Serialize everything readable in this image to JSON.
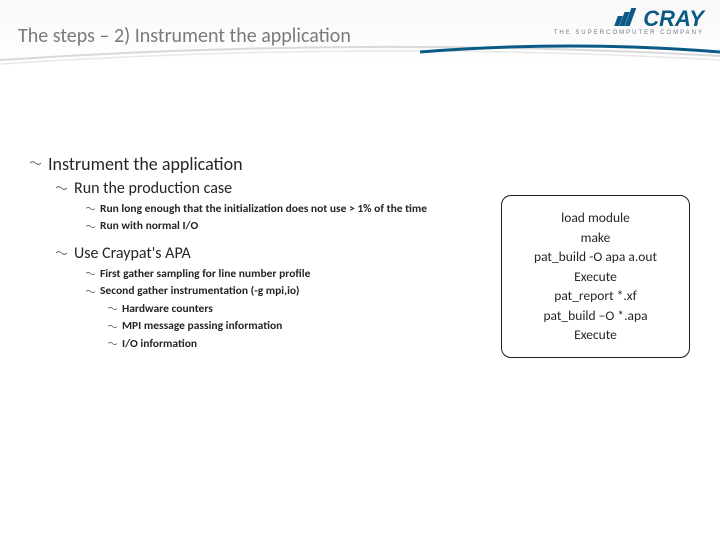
{
  "brand": {
    "name": "CRAY",
    "tagline": "THE SUPERCOMPUTER COMPANY"
  },
  "title": "The steps – 2) Instrument the application",
  "content": {
    "l1": "Instrument the application",
    "l2a": "Run the production case",
    "l3a": "Run long enough that the initialization does not use > 1% of the time",
    "l3b": "Run with normal I/O",
    "l2b": "Use Craypat's APA",
    "l3c": "First gather sampling for line number profile",
    "l3d": "Second gather instrumentation (-g mpi,io)",
    "l4a": "Hardware counters",
    "l4b": "MPI message passing information",
    "l4c": "I/O information"
  },
  "card": {
    "line1": "load module",
    "line2": "make",
    "line3": "pat_build -O apa a.out",
    "line4": "Execute",
    "line5": "pat_report *.xf",
    "line6": "pat_build –O *.apa",
    "line7": "Execute"
  }
}
